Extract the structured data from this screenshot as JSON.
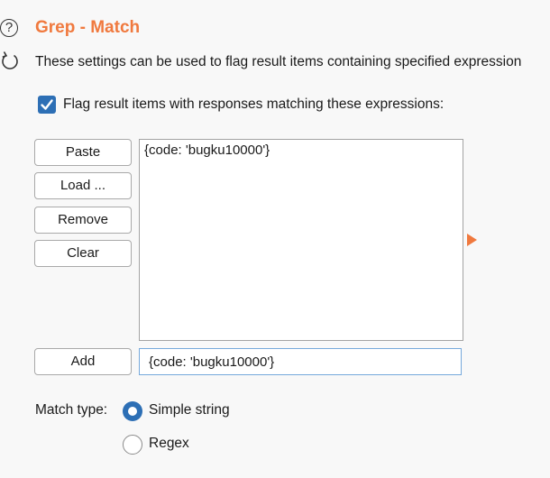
{
  "header": {
    "help_icon_glyph": "?",
    "title": "Grep - Match",
    "description": "These settings can be used to flag result items containing specified expression"
  },
  "flag_checkbox": {
    "checked": true,
    "label": "Flag result items with responses matching these expressions:"
  },
  "buttons": {
    "paste": "Paste",
    "load": "Load ...",
    "remove": "Remove",
    "clear": "Clear",
    "add": "Add"
  },
  "expressions": [
    "{code: 'bugku10000'}"
  ],
  "add_input": {
    "value": "{code: 'bugku10000'}"
  },
  "match_type": {
    "label": "Match type:",
    "options": [
      "Simple string",
      "Regex"
    ],
    "selected": "Simple string"
  },
  "colors": {
    "accent": "#f0793e",
    "primary": "#2d6fb5"
  }
}
